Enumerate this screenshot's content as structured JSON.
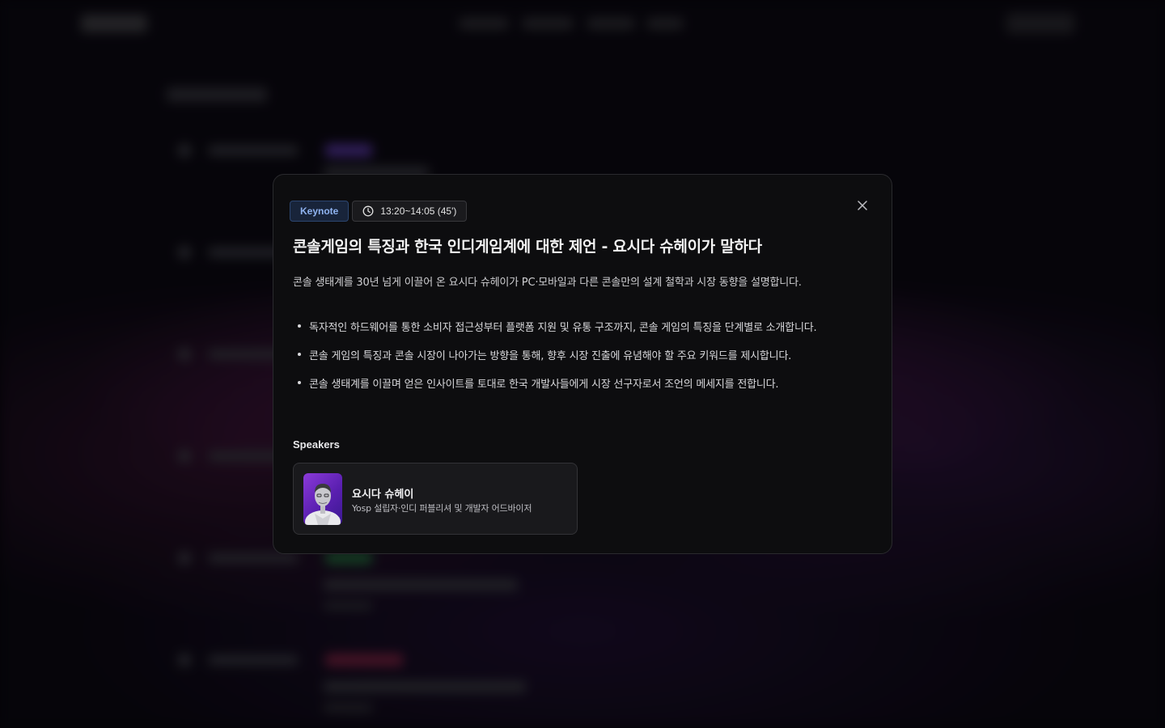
{
  "session": {
    "category": "Keynote",
    "time": "13:20~14:05 (45')",
    "title": "콘솔게임의 특징과 한국 인디게임계에 대한 제언 - 요시다 슈헤이가 말하다",
    "description": "콘솔 생태계를 30년 넘게 이끌어 온 요시다 슈헤이가 PC·모바일과 다른 콘솔만의 설계 철학과 시장 동향을 설명합니다.",
    "bullets": [
      "독자적인 하드웨어를 통한 소비자 접근성부터 플랫폼 지원 및 유통 구조까지, 콘솔 게임의 특징을 단계별로 소개합니다.",
      "콘솔 게임의 특징과 콘솔 시장이 나아가는 방향을 통해, 향후 시장 진출에 유념해야 할 주요 키워드를 제시합니다.",
      "콘솔 생태계를 이끌며 얻은 인사이트를 토대로 한국 개발사들에게 시장 선구자로서 조언의 메세지를 전합니다."
    ]
  },
  "speakers_heading": "Speakers",
  "speakers": [
    {
      "name": "요시다 슈헤이",
      "role": "Yosp 설립자·인디 퍼블리셔 및 개발자 어드바이저"
    }
  ],
  "colors": {
    "keynote_badge_text": "#8fb3f0",
    "keynote_badge_bg": "#18243a",
    "modal_bg": "#0d0d0f",
    "avatar_bg": "#6a2bc4"
  },
  "icons": {
    "time": "clock-icon",
    "close": "close-icon"
  }
}
